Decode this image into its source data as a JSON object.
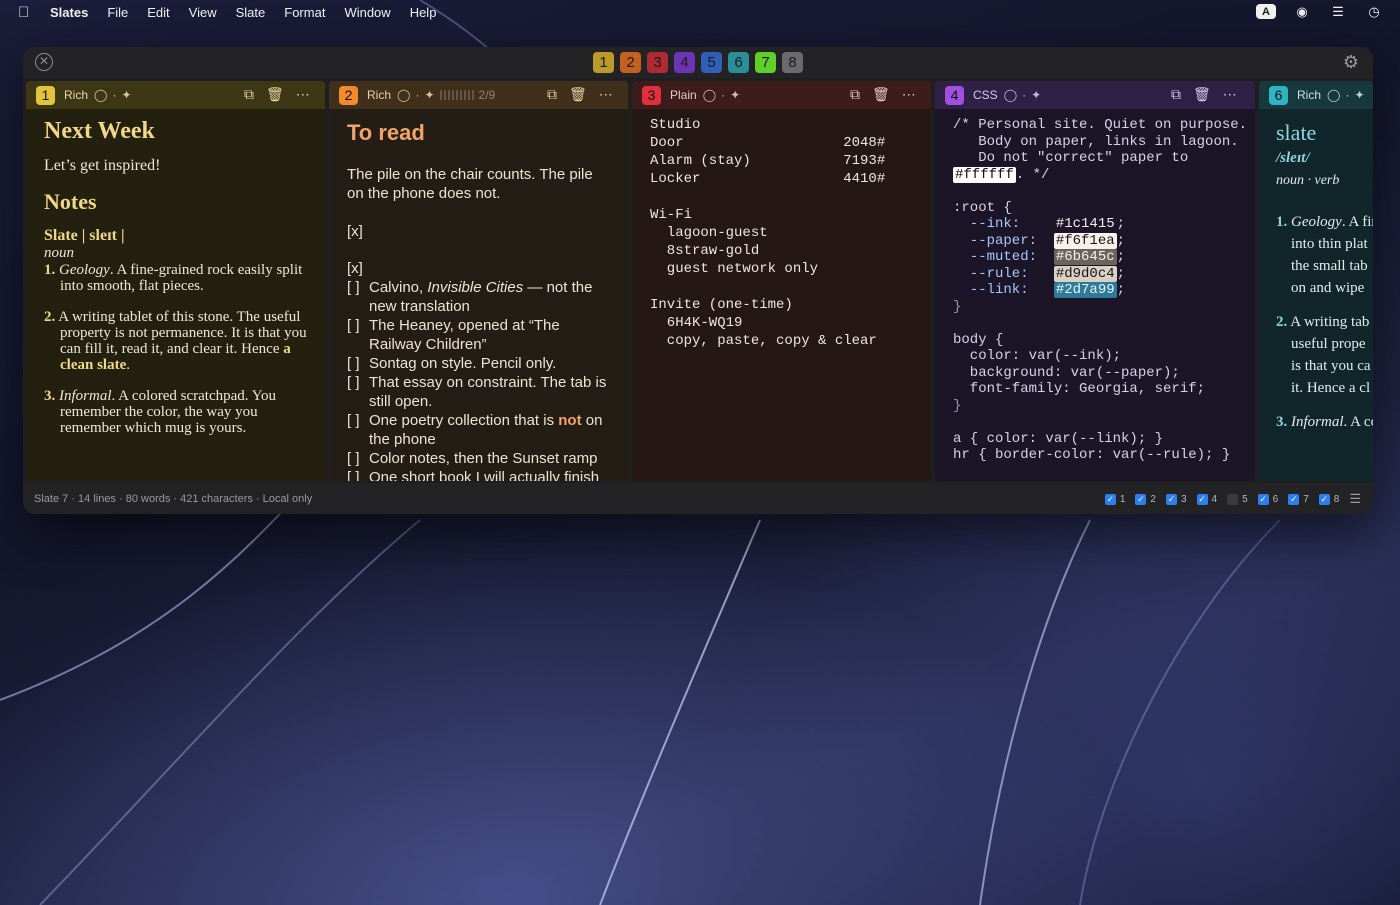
{
  "menubar": {
    "app": "Slates",
    "items": [
      "File",
      "Edit",
      "View",
      "Slate",
      "Format",
      "Window",
      "Help"
    ],
    "status_letter": "A"
  },
  "tabs": [
    {
      "label": "1",
      "color": "#b99a2a"
    },
    {
      "label": "2",
      "color": "#c4611f"
    },
    {
      "label": "3",
      "color": "#b02a35"
    },
    {
      "label": "4",
      "color": "#6d35b5"
    },
    {
      "label": "5",
      "color": "#2f5fb8"
    },
    {
      "label": "6",
      "color": "#2a8e99"
    },
    {
      "label": "7",
      "color": "#5fcf2a"
    },
    {
      "label": "8",
      "color": "#6b6b6e"
    }
  ],
  "panels": {
    "p1": {
      "badge": "1",
      "mode": "Rich",
      "title": "Next Week",
      "lead": "Let’s get inspired!",
      "heading": "Notes",
      "word": "Slate | sleɪt |",
      "pos": "noun",
      "items": [
        {
          "num": "1.",
          "term": "Geology",
          "text": ". A fine-grained rock easily split into smooth, flat pieces."
        },
        {
          "num": "2.",
          "text_a": "A writing tablet of this stone. The useful property is not permanence. It is that you can fill it, read it, and clear it. Hence ",
          "accent": "a clean slate",
          "text_b": "."
        },
        {
          "num": "3.",
          "term": "Informal",
          "text": ". A colored scratchpad. You remember the color, the way you remember which mug is yours."
        }
      ]
    },
    "p2": {
      "badge": "2",
      "mode": "Rich",
      "count": "2/9",
      "title": "To read",
      "intro": "The pile on the chair counts. The pile on the phone does not.",
      "done1": "[x]",
      "done2": "[x]",
      "unchecked": "[ ]",
      "items": [
        {
          "pre": "Calvino, ",
          "italic": "Invisible Cities",
          "post": " — not the new translation"
        },
        {
          "text": "The Heaney, opened at “The Railway Children”"
        },
        {
          "text": "Sontag on style. Pencil only."
        },
        {
          "text": "That essay on constraint. The tab is still open."
        },
        {
          "pre": "One poetry collection that is ",
          "strong": "not",
          "post": " on the phone"
        },
        {
          "text": "Color notes, then the Sunset ramp"
        },
        {
          "text": "One short book I will actually finish"
        }
      ]
    },
    "p3": {
      "badge": "3",
      "mode": "Plain",
      "lines": [
        "Studio",
        "Door                   2048#",
        "Alarm (stay)           7193#",
        "Locker                 4410#",
        "",
        "Wi-Fi",
        "  lagoon-guest",
        "  8straw-gold",
        "  guest network only",
        "",
        "Invite (one-time)",
        "  6H4K-WQ19",
        "  copy, paste, copy & clear"
      ]
    },
    "p4": {
      "badge": "4",
      "mode": "CSS",
      "comment": [
        "/* Personal site. Quiet on purpose.",
        "   Body on paper, links in lagoon.",
        "   Do not \"correct\" paper to"
      ],
      "white": "#ffffff",
      "comment_end": ". */",
      "root": ":root {",
      "vars": [
        {
          "name": "  --ink:    ",
          "value": "#1c1415",
          "bg": "",
          "fg": "#eeeeee"
        },
        {
          "name": "  --paper:  ",
          "value": "#f6f1ea",
          "bg": "#f6f1ea",
          "fg": "#1c1415"
        },
        {
          "name": "  --muted:  ",
          "value": "#6b645c",
          "bg": "#6b645c",
          "fg": "#f6f1ea"
        },
        {
          "name": "  --rule:   ",
          "value": "#d9d0c4",
          "bg": "#d9d0c4",
          "fg": "#1c1415"
        },
        {
          "name": "  --link:   ",
          "value": "#2d7a99",
          "bg": "#2d7a99",
          "fg": "#eaf6fa"
        }
      ],
      "close": "}",
      "body_lines": [
        "body {",
        "  color: var(--ink);",
        "  background: var(--paper);",
        "  font-family: Georgia, serif;",
        "}",
        "",
        "a { color: var(--link); }",
        "hr { border-color: var(--rule); }"
      ]
    },
    "p6": {
      "badge": "6",
      "mode": "Rich",
      "title": "slate",
      "phon": "/sleɪt/",
      "pos": "noun · verb",
      "items": [
        {
          "num": "1.",
          "term": "Geology",
          "text": ". A fir"
        },
        {
          "text": "into thin plat"
        },
        {
          "text": "the small tab"
        },
        {
          "text": "on and wipe"
        },
        {
          "num": "2.",
          "text": "A writing tab"
        },
        {
          "text": "useful prope"
        },
        {
          "text": "is that you ca"
        },
        {
          "text": "it. Hence a cl"
        },
        {
          "num": "3.",
          "term": "Informal",
          "text": ". A co"
        }
      ]
    }
  },
  "status": {
    "text": "Slate 7 · 14 lines · 80 words · 421 characters · Local only",
    "toggles": [
      {
        "label": "1",
        "on": true
      },
      {
        "label": "2",
        "on": true
      },
      {
        "label": "3",
        "on": true
      },
      {
        "label": "4",
        "on": true
      },
      {
        "label": "5",
        "on": false
      },
      {
        "label": "6",
        "on": true
      },
      {
        "label": "7",
        "on": true
      },
      {
        "label": "8",
        "on": true
      }
    ]
  }
}
